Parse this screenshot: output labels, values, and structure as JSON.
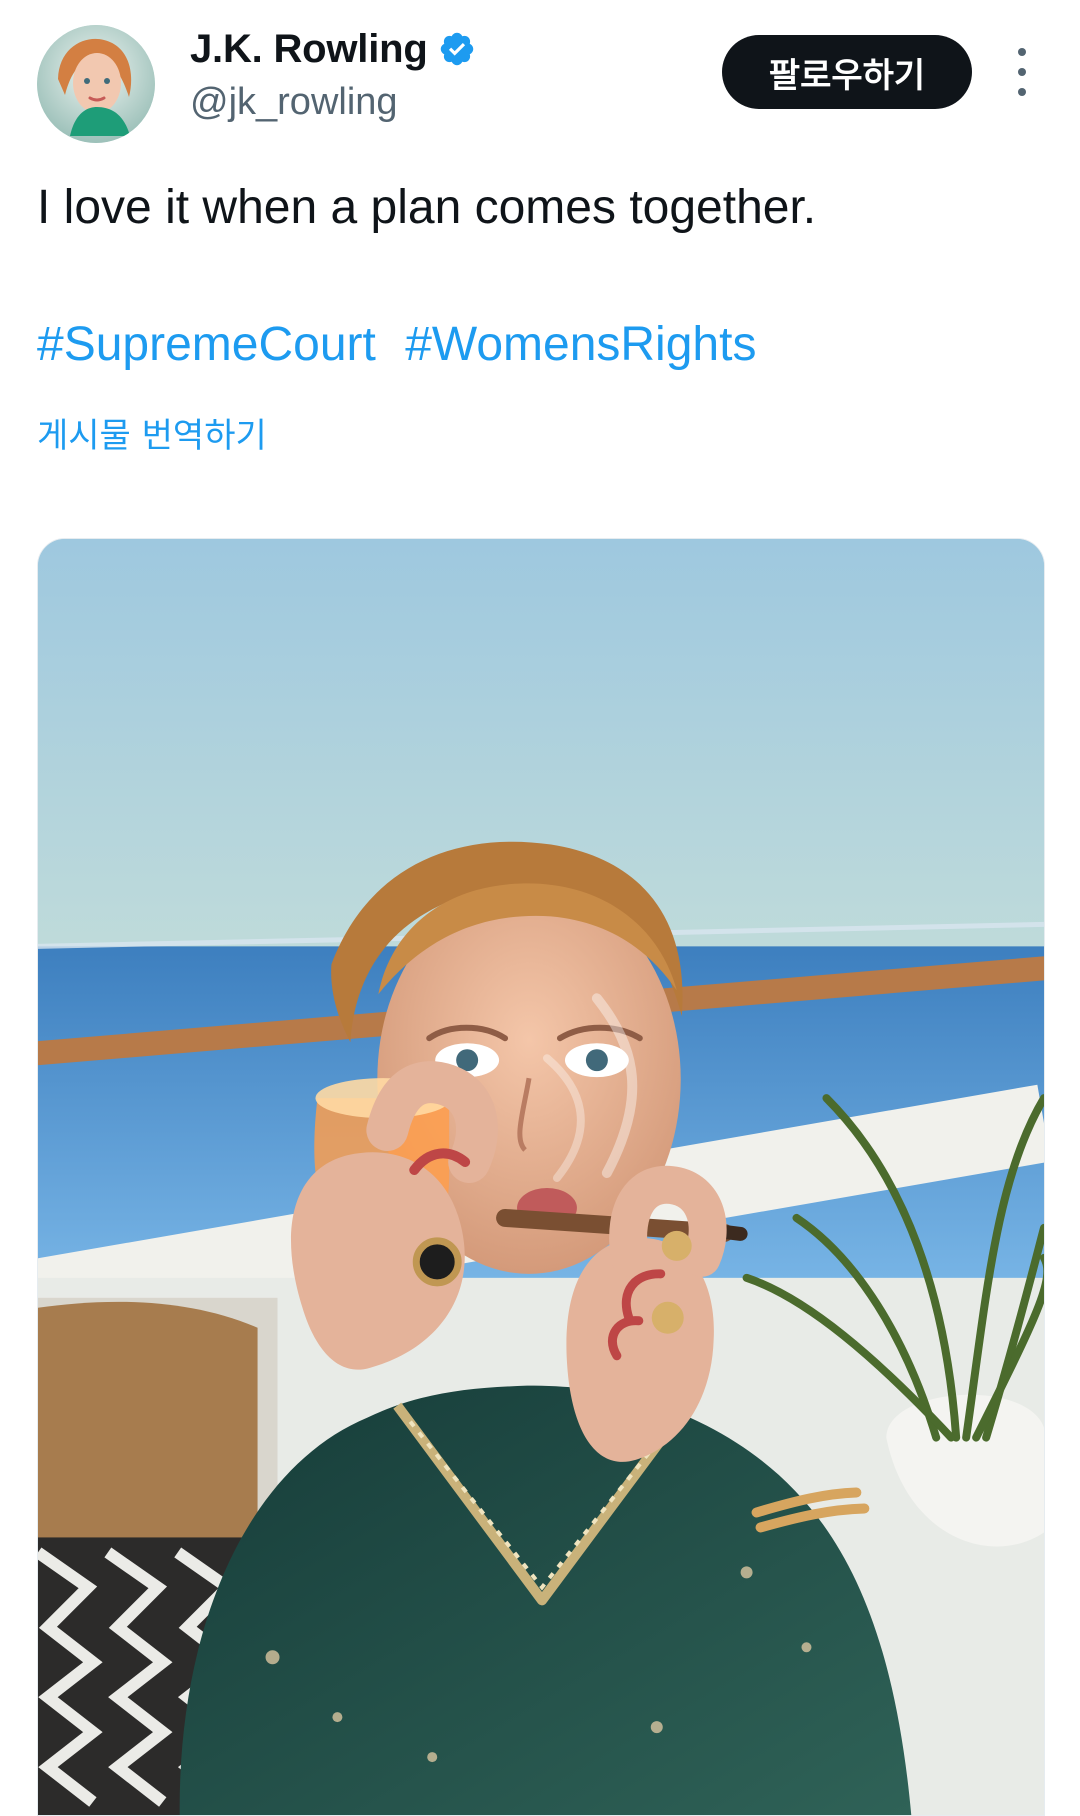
{
  "author": {
    "display_name": "J.K. Rowling",
    "handle": "@jk_rowling",
    "verified_icon": "verified-badge-icon",
    "avatar_icon": "profile-avatar"
  },
  "actions": {
    "follow_label": "팔로우하기",
    "more_icon": "more-vertical-icon"
  },
  "tweet": {
    "text": "I love it when a plan comes together.",
    "hashtags": [
      "#SupremeCourt",
      "#WomensRights"
    ],
    "translate_label": "게시물 번역하기"
  },
  "media": {
    "type": "photo"
  },
  "colors": {
    "link": "#1d9bf0",
    "text": "#0f1419",
    "secondary": "#536471",
    "button": "#0f1419"
  }
}
